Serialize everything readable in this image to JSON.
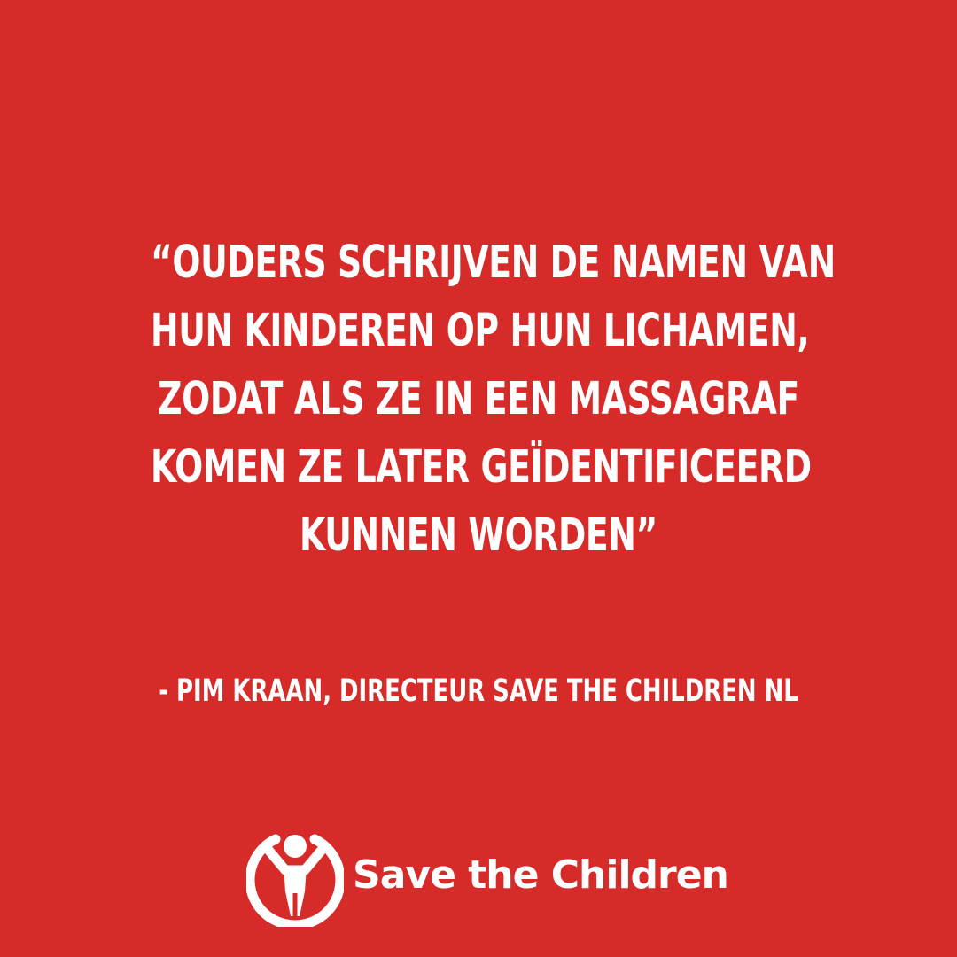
{
  "colors": {
    "background": "#d62b28",
    "text": "#ffffff"
  },
  "quote": {
    "lines": [
      "“OUDERS SCHRIJVEN DE NAMEN VAN",
      "HUN KINDEREN OP HUN LICHAMEN,",
      "ZODAT ALS ZE IN EEN MASSAGRAF",
      "KOMEN ZE LATER GEÏDENTIFICEERD",
      "KUNNEN WORDEN”"
    ]
  },
  "attribution": "- PIM KRAAN, DIRECTEUR SAVE THE CHILDREN NL",
  "logo": {
    "icon": "save-the-children-child-figure-icon",
    "wordmark": "Save the Children"
  }
}
